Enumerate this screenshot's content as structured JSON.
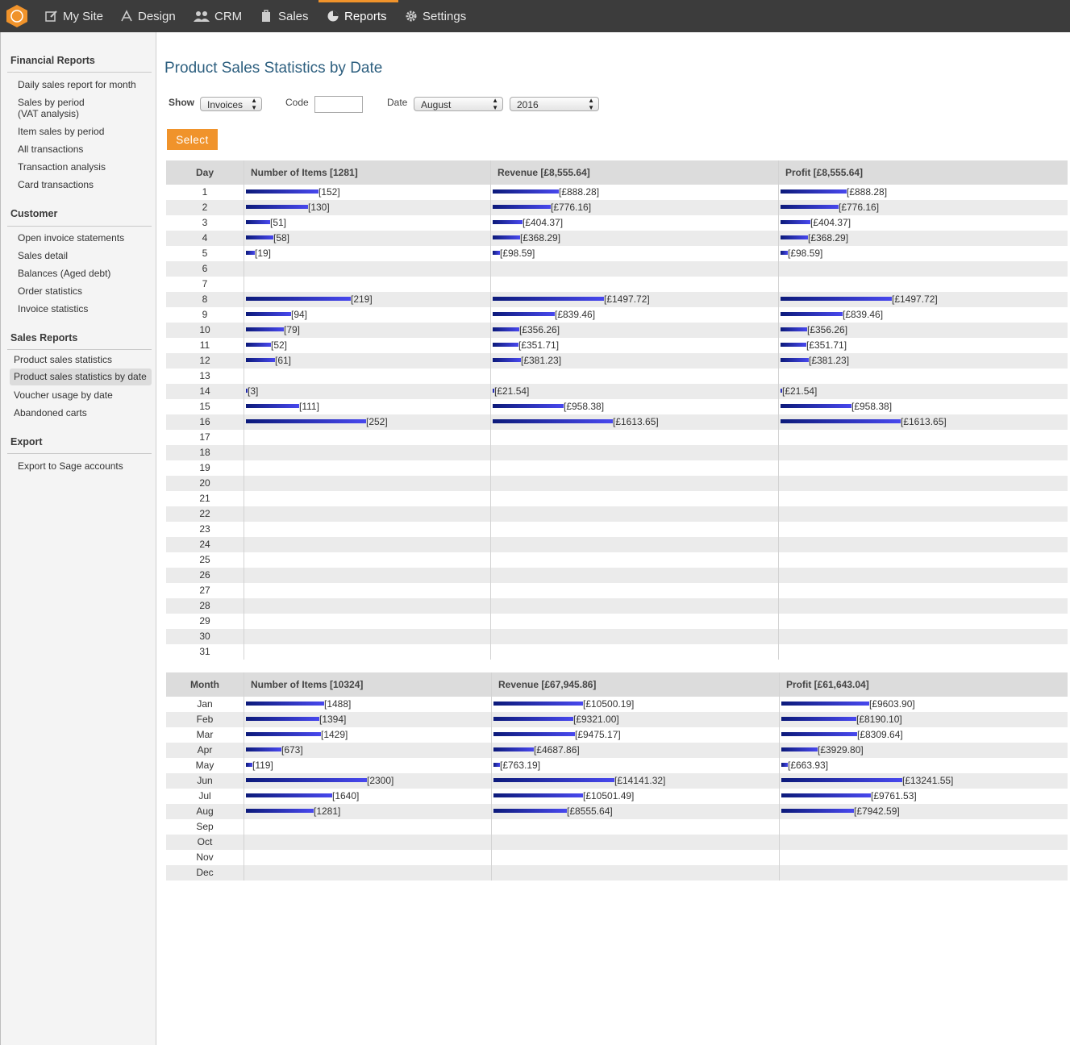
{
  "nav": [
    {
      "label": "My Site",
      "icon": "edit-icon"
    },
    {
      "label": "Design",
      "icon": "design-icon"
    },
    {
      "label": "CRM",
      "icon": "users-icon"
    },
    {
      "label": "Sales",
      "icon": "bag-icon"
    },
    {
      "label": "Reports",
      "icon": "pie-chart-icon",
      "active": true
    },
    {
      "label": "Settings",
      "icon": "gear-icon"
    }
  ],
  "sidebar": {
    "financial": {
      "heading": "Financial Reports",
      "items": [
        "Daily sales report for month",
        "Sales by period\n(VAT analysis)",
        "Item sales by period",
        "All transactions",
        "Transaction analysis",
        "Card transactions"
      ]
    },
    "customer": {
      "heading": "Customer",
      "items": [
        "Open invoice statements",
        "Sales detail",
        "Balances (Aged debt)",
        "Order statistics",
        "Invoice statistics"
      ]
    },
    "sales": {
      "heading": "Sales Reports",
      "items": [
        "Product sales statistics",
        "Product sales statistics by date",
        "Voucher usage by date",
        "Abandoned carts"
      ],
      "active_index": 1
    },
    "export": {
      "heading": "Export",
      "items": [
        "Export to Sage accounts"
      ]
    }
  },
  "page_title": "Product Sales Statistics by Date",
  "filters": {
    "show_label": "Show",
    "show_value": "Invoices",
    "code_label": "Code",
    "code_value": "",
    "date_label": "Date",
    "month_value": "August",
    "year_value": "2016",
    "select_button": "Select"
  },
  "daily": {
    "headers": {
      "day": "Day",
      "items": "Number of Items [1281]",
      "revenue": "Revenue [£8,555.64]",
      "profit": "Profit [£8,555.64]"
    },
    "rows": [
      {
        "day": "1",
        "items": 152,
        "revenue": 888.28,
        "profit": 888.28
      },
      {
        "day": "2",
        "items": 130,
        "revenue": 776.16,
        "profit": 776.16
      },
      {
        "day": "3",
        "items": 51,
        "revenue": 404.37,
        "profit": 404.37
      },
      {
        "day": "4",
        "items": 58,
        "revenue": 368.29,
        "profit": 368.29
      },
      {
        "day": "5",
        "items": 19,
        "revenue": 98.59,
        "profit": 98.59
      },
      {
        "day": "6"
      },
      {
        "day": "7"
      },
      {
        "day": "8",
        "items": 219,
        "revenue": 1497.72,
        "profit": 1497.72
      },
      {
        "day": "9",
        "items": 94,
        "revenue": 839.46,
        "profit": 839.46
      },
      {
        "day": "10",
        "items": 79,
        "revenue": 356.26,
        "profit": 356.26
      },
      {
        "day": "11",
        "items": 52,
        "revenue": 351.71,
        "profit": 351.71
      },
      {
        "day": "12",
        "items": 61,
        "revenue": 381.23,
        "profit": 381.23
      },
      {
        "day": "13"
      },
      {
        "day": "14",
        "items": 3,
        "revenue": 21.54,
        "profit": 21.54
      },
      {
        "day": "15",
        "items": 111,
        "revenue": 958.38,
        "profit": 958.38
      },
      {
        "day": "16",
        "items": 252,
        "revenue": 1613.65,
        "profit": 1613.65
      },
      {
        "day": "17"
      },
      {
        "day": "18"
      },
      {
        "day": "19"
      },
      {
        "day": "20"
      },
      {
        "day": "21"
      },
      {
        "day": "22"
      },
      {
        "day": "23"
      },
      {
        "day": "24"
      },
      {
        "day": "25"
      },
      {
        "day": "26"
      },
      {
        "day": "27"
      },
      {
        "day": "28"
      },
      {
        "day": "29"
      },
      {
        "day": "30"
      },
      {
        "day": "31"
      }
    ]
  },
  "monthly": {
    "headers": {
      "day": "Month",
      "items": "Number of Items [10324]",
      "revenue": "Revenue [£67,945.86]",
      "profit": "Profit [£61,643.04]"
    },
    "rows": [
      {
        "day": "Jan",
        "items": 1488,
        "revenue": 10500.19,
        "profit": 9603.9
      },
      {
        "day": "Feb",
        "items": 1394,
        "revenue": 9321.0,
        "profit": 8190.1
      },
      {
        "day": "Mar",
        "items": 1429,
        "revenue": 9475.17,
        "profit": 8309.64
      },
      {
        "day": "Apr",
        "items": 673,
        "revenue": 4687.86,
        "profit": 3929.8
      },
      {
        "day": "May",
        "items": 119,
        "revenue": 763.19,
        "profit": 663.93
      },
      {
        "day": "Jun",
        "items": 2300,
        "revenue": 14141.32,
        "profit": 13241.55
      },
      {
        "day": "Jul",
        "items": 1640,
        "revenue": 10501.49,
        "profit": 9761.53
      },
      {
        "day": "Aug",
        "items": 1281,
        "revenue": 8555.64,
        "profit": 7942.59
      },
      {
        "day": "Sep"
      },
      {
        "day": "Oct"
      },
      {
        "day": "Nov"
      },
      {
        "day": "Dec"
      }
    ]
  }
}
